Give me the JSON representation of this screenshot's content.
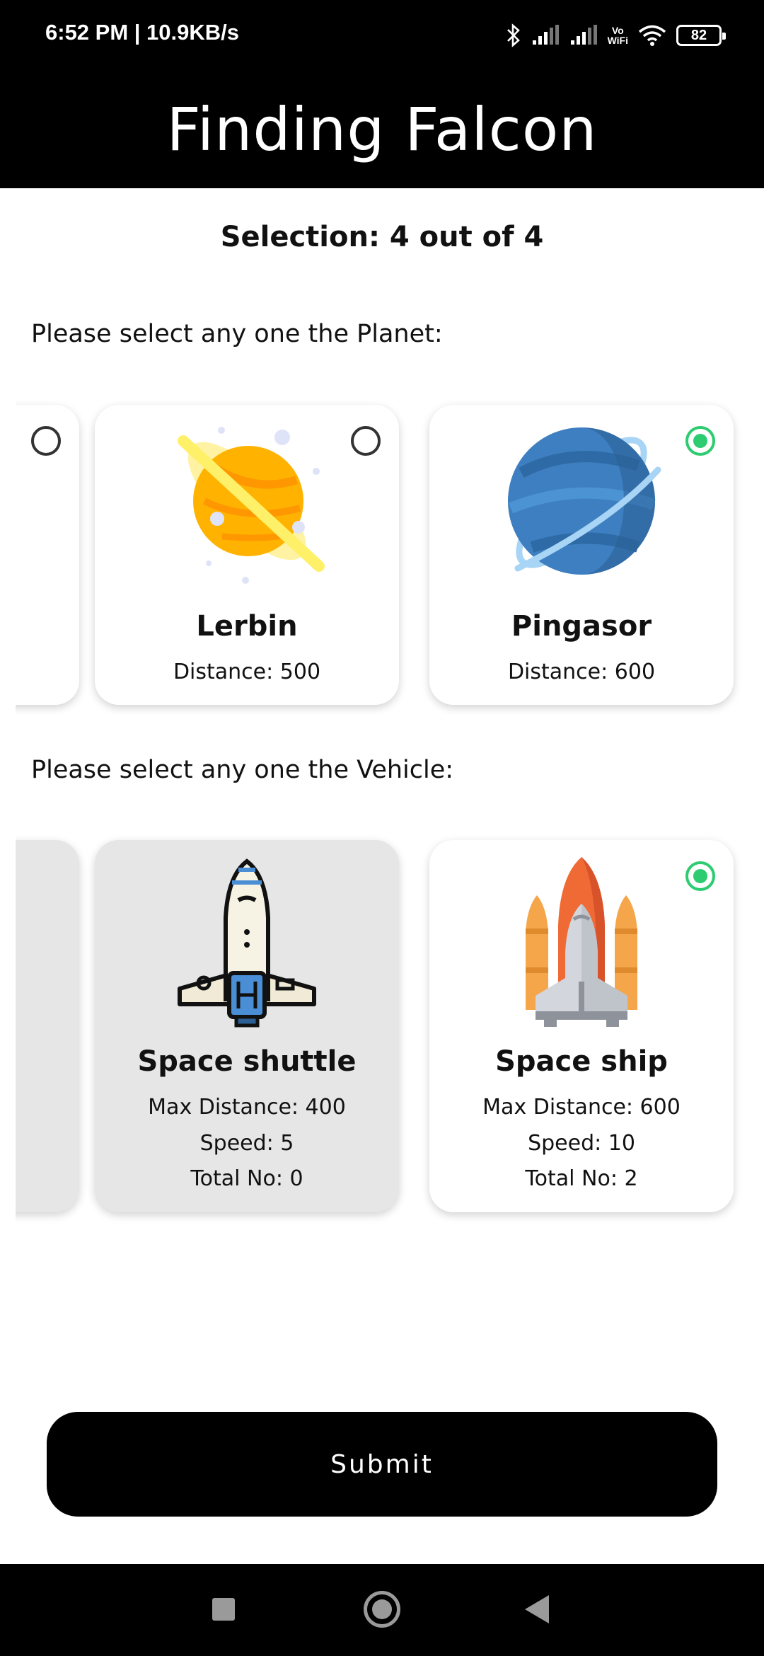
{
  "status_bar": {
    "time": "6:52 PM | 10.9KB/s",
    "volte_top": "Vo",
    "volte_bottom": "WiFi",
    "battery": "82"
  },
  "header": {
    "title": "Finding Falcon"
  },
  "selection": {
    "text": "Selection: 4 out of 4"
  },
  "planet_section": {
    "label": "Please select any one the Planet:",
    "planets": [
      {
        "name": "Lerbin",
        "distance": "Distance: 500",
        "selected": false,
        "icon": "saturn-planet-icon"
      },
      {
        "name": "Pingasor",
        "distance": "Distance: 600",
        "selected": true,
        "icon": "blue-ringed-planet-icon"
      }
    ]
  },
  "vehicle_section": {
    "label": "Please select any one the Vehicle:",
    "vehicles": [
      {
        "name": "Space shuttle",
        "max_distance": "Max Distance: 400",
        "speed": "Speed: 5",
        "total": "Total No: 0",
        "selected": false,
        "disabled": true,
        "icon": "space-shuttle-icon"
      },
      {
        "name": "Space ship",
        "max_distance": "Max Distance: 600",
        "speed": "Speed: 10",
        "total": "Total No: 2",
        "selected": true,
        "disabled": false,
        "icon": "space-ship-icon"
      }
    ]
  },
  "submit": {
    "label": "Submit"
  },
  "colors": {
    "accent": "#2ecc71",
    "header": "#000000",
    "disabled_card": "#e6e6e6"
  }
}
